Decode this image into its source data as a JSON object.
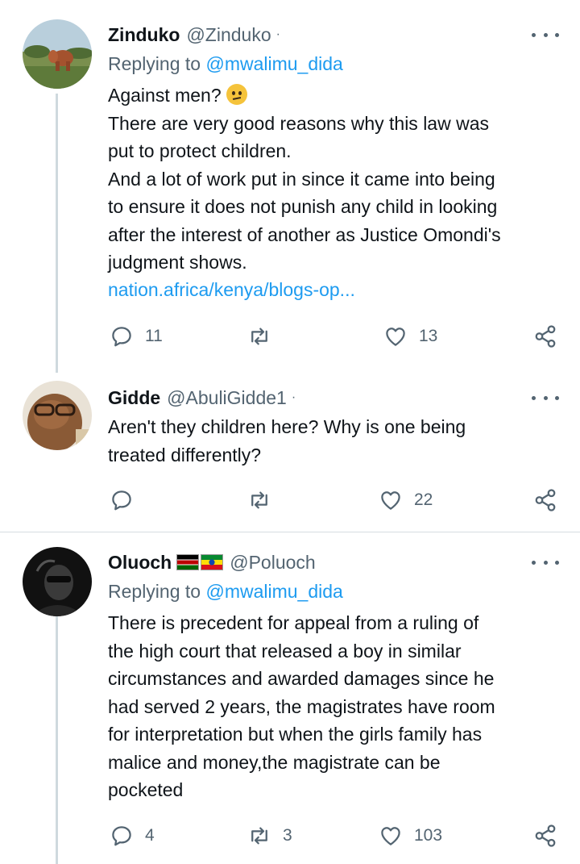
{
  "tweets": [
    {
      "name": "Zinduko",
      "handle": "@Zinduko",
      "dot": "·",
      "replying_label": "Replying to",
      "replying_to": "@mwalimu_dida",
      "text": "Against men?",
      "text_after_emoji": "There are very good reasons why this law was\nput to protect children.\nAnd a lot of work put in since it came into being\nto ensure it does not punish any child in looking\nafter the interest of another as Justice Omondi's\njudgment shows.",
      "link": "nation.africa/kenya/blogs-op...",
      "replies": "11",
      "retweets": "",
      "likes": "13",
      "emoji_icon": "confused-face-icon"
    },
    {
      "name": "Gidde",
      "handle": "@AbuliGidde1",
      "dot": "·",
      "text": "Aren't they children here? Why is one being\ntreated differently?",
      "replies": "",
      "retweets": "",
      "likes": "22"
    },
    {
      "name": "Oluoch",
      "handle": "@Poluoch",
      "dot": "",
      "replying_label": "Replying to",
      "replying_to": "@mwalimu_dida",
      "text": "There is precedent for appeal from a ruling of\nthe high court that released a boy in similar\ncircumstances and awarded damages since he\nhad served 2 years, the magistrates have room\nfor interpretation but when the girls family has\nmalice and money,the magistrate can be\npocketed",
      "replies": "4",
      "retweets": "3",
      "likes": "103",
      "flags": [
        "kenya-flag-icon",
        "ethiopia-flag-icon"
      ]
    }
  ],
  "colors": {
    "text": "#0f1419",
    "secondary": "#536471",
    "accent": "#1d9bf0",
    "thread_line": "#cfd9de"
  }
}
